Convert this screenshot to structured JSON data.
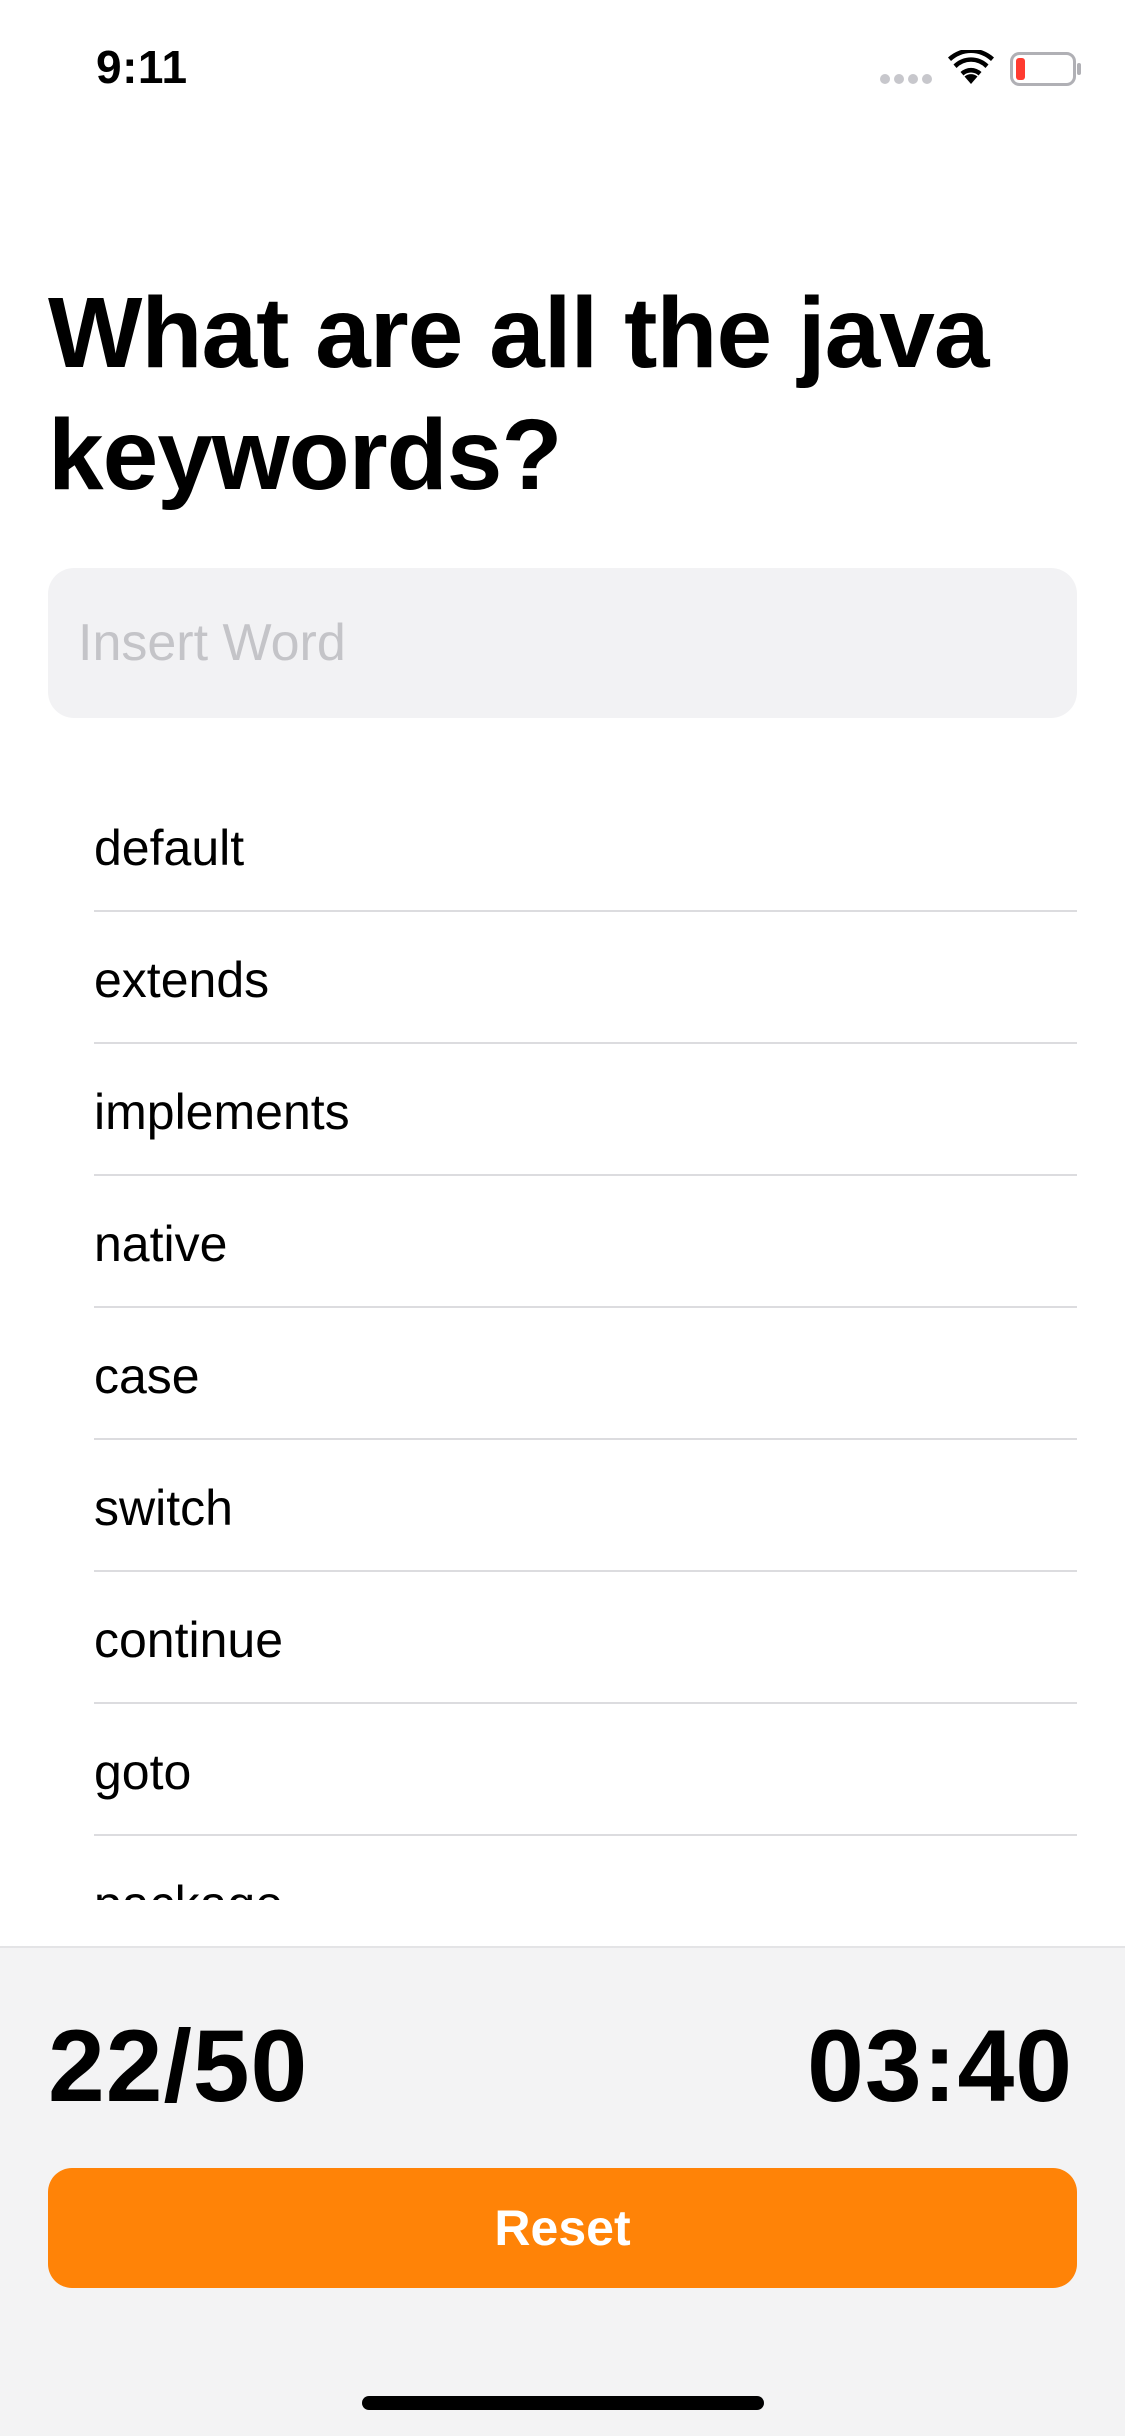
{
  "status_bar": {
    "time": "9:11",
    "icons": [
      "signal-icon",
      "wifi-icon",
      "battery-icon"
    ],
    "battery_level_color": "#ff3b30"
  },
  "quiz": {
    "title": "What are all the java keywords?",
    "input": {
      "placeholder": "Insert Word",
      "value": ""
    }
  },
  "answers": [
    {
      "label": "default"
    },
    {
      "label": "extends"
    },
    {
      "label": "implements"
    },
    {
      "label": "native"
    },
    {
      "label": "case"
    },
    {
      "label": "switch"
    },
    {
      "label": "continue"
    },
    {
      "label": "goto"
    },
    {
      "label": "package"
    }
  ],
  "footer": {
    "score": "22/50",
    "timer": "03:40",
    "reset_label": "Reset"
  },
  "colors": {
    "accent": "#ff8307",
    "background": "#ffffff",
    "panel": "#f3f3f4",
    "input_background": "#f2f2f4"
  }
}
